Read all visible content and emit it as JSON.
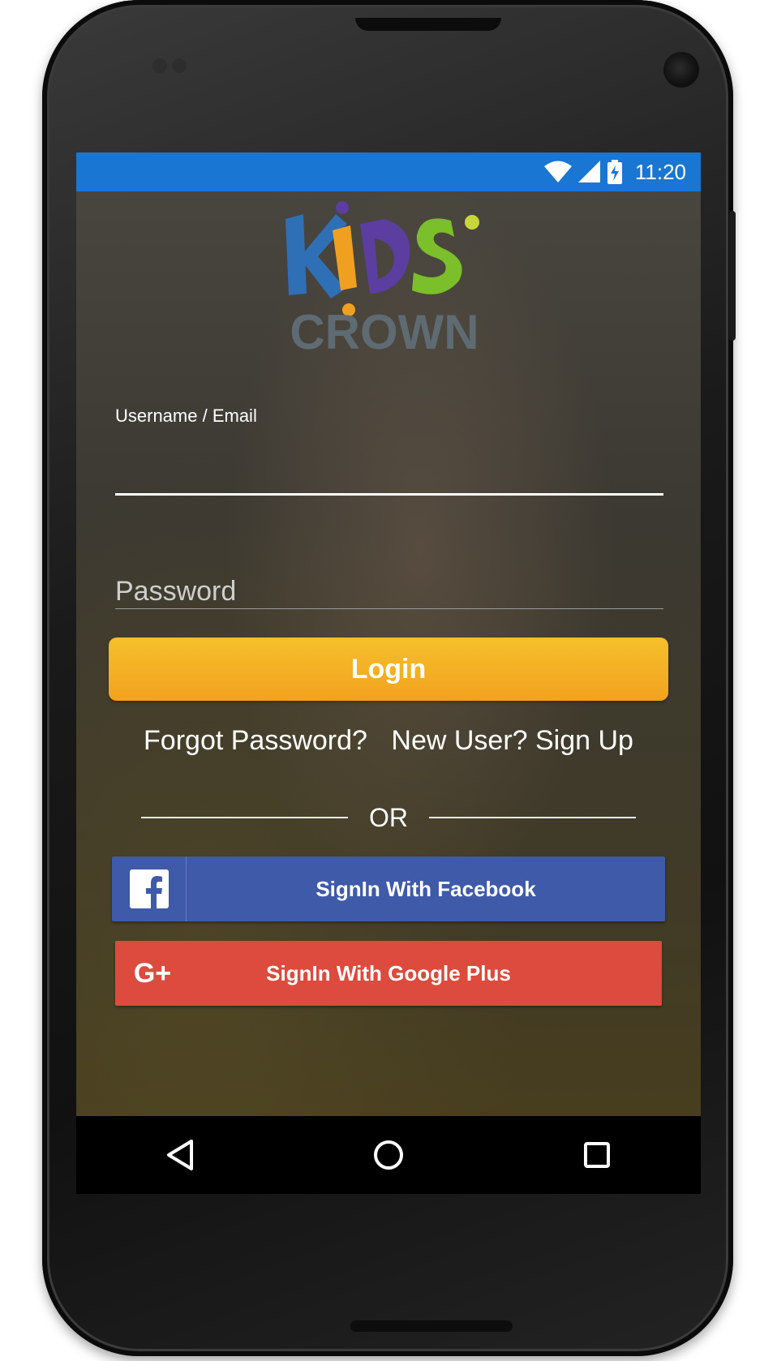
{
  "status_bar": {
    "time": "11:20",
    "icons": [
      "wifi-icon",
      "signal-icon",
      "battery-charging-icon"
    ],
    "bg_color": "#1976d2"
  },
  "logo": {
    "line1": "KiDS",
    "line2": "CROWN",
    "colors": {
      "k": "#2f6fb6",
      "i": "#f0a020",
      "d": "#5b3ea0",
      "s": "#7bbf2a",
      "crown": "#5f6b73"
    }
  },
  "form": {
    "username_label": "Username / Email",
    "username_value": "",
    "password_placeholder": "Password",
    "login_label": "Login",
    "forgot_label": "Forgot Password?",
    "signup_label": "New User? Sign Up",
    "or_label": "OR"
  },
  "social": {
    "facebook_label": "SignIn With Facebook",
    "facebook_icon": "facebook-icon",
    "google_label": "SignIn With Google Plus",
    "google_icon_text": "G+"
  },
  "nav": {
    "items": [
      "back-icon",
      "home-icon",
      "recents-icon"
    ]
  },
  "colors": {
    "login_button": "#f3a21e",
    "facebook_button": "#3f5aa8",
    "google_button": "#dc4b3e"
  }
}
